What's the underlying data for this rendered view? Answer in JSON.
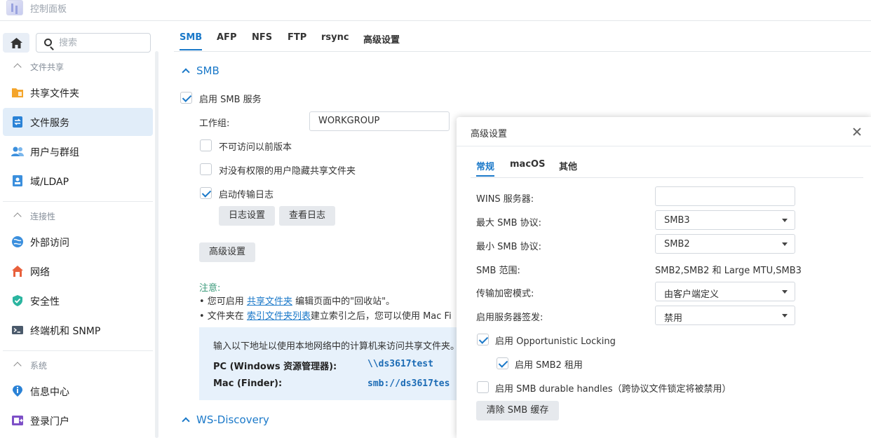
{
  "app": {
    "title": "控制面板"
  },
  "sidebar": {
    "search_placeholder": "搜索",
    "sections": [
      {
        "label": "文件共享",
        "items": [
          {
            "label": "共享文件夹",
            "icon": "folder-icon"
          },
          {
            "label": "文件服务",
            "icon": "file-services-icon",
            "active": true
          },
          {
            "label": "用户与群组",
            "icon": "users-icon"
          },
          {
            "label": "域/LDAP",
            "icon": "domain-icon"
          }
        ]
      },
      {
        "label": "连接性",
        "items": [
          {
            "label": "外部访问",
            "icon": "external-access-icon"
          },
          {
            "label": "网络",
            "icon": "network-icon"
          },
          {
            "label": "安全性",
            "icon": "shield-icon"
          },
          {
            "label": "终端机和 SNMP",
            "icon": "terminal-icon"
          }
        ]
      },
      {
        "label": "系统",
        "items": [
          {
            "label": "信息中心",
            "icon": "info-icon"
          },
          {
            "label": "登录门户",
            "icon": "login-portal-icon"
          }
        ]
      }
    ]
  },
  "main": {
    "tabs": [
      "SMB",
      "AFP",
      "NFS",
      "FTP",
      "rsync",
      "高级设置"
    ],
    "smb_section_title": "SMB",
    "enable_smb": "启用 SMB 服务",
    "workgroup_label": "工作组:",
    "workgroup_value": "WORKGROUP",
    "disable_previous_versions": "不可访问以前版本",
    "hide_folders": "对没有权限的用户隐藏共享文件夹",
    "enable_transfer_log": "启动传输日志",
    "log_settings_button": "日志设置",
    "view_logs_button": "查看日志",
    "advanced_button": "高级设置",
    "note_title": "注意:",
    "note1_prefix": "• 您可启用 ",
    "note1_link": "共享文件夹",
    "note1_suffix": " 编辑页面中的\"回收站\"。",
    "note2_prefix": "• 文件夹在 ",
    "note2_link": "索引文件夹列表",
    "note2_suffix": "建立索引之后，您可以使用 Mac Fi",
    "info_text": "输入以下地址以使用本地网络中的计算机来访问共享文件夹。",
    "pc_label": "PC (Windows 资源管理器):",
    "pc_value": "\\\\ds3617test",
    "mac_label": "Mac (Finder):",
    "mac_value": "smb://ds3617tes",
    "ws_section_title": "WS-Discovery"
  },
  "dialog": {
    "title": "高级设置",
    "tabs": [
      "常规",
      "macOS",
      "其他"
    ],
    "wins_label": "WINS 服务器:",
    "wins_value": "",
    "max_smb_label": "最大 SMB 协议:",
    "max_smb_value": "SMB3",
    "min_smb_label": "最小 SMB 协议:",
    "min_smb_value": "SMB2",
    "smb_range_label": "SMB 范围:",
    "smb_range_value": "SMB2,SMB2 和 Large MTU,SMB3",
    "encryption_label": "传输加密模式:",
    "encryption_value": "由客户端定义",
    "signing_label": "启用服务器签发:",
    "signing_value": "禁用",
    "oplock": "启用 Opportunistic Locking",
    "smb2_lease": "启用 SMB2 租用",
    "durable_handles": "启用 SMB durable handles（跨协议文件锁定将被禁用）",
    "clear_cache_button": "清除 SMB 缓存"
  }
}
